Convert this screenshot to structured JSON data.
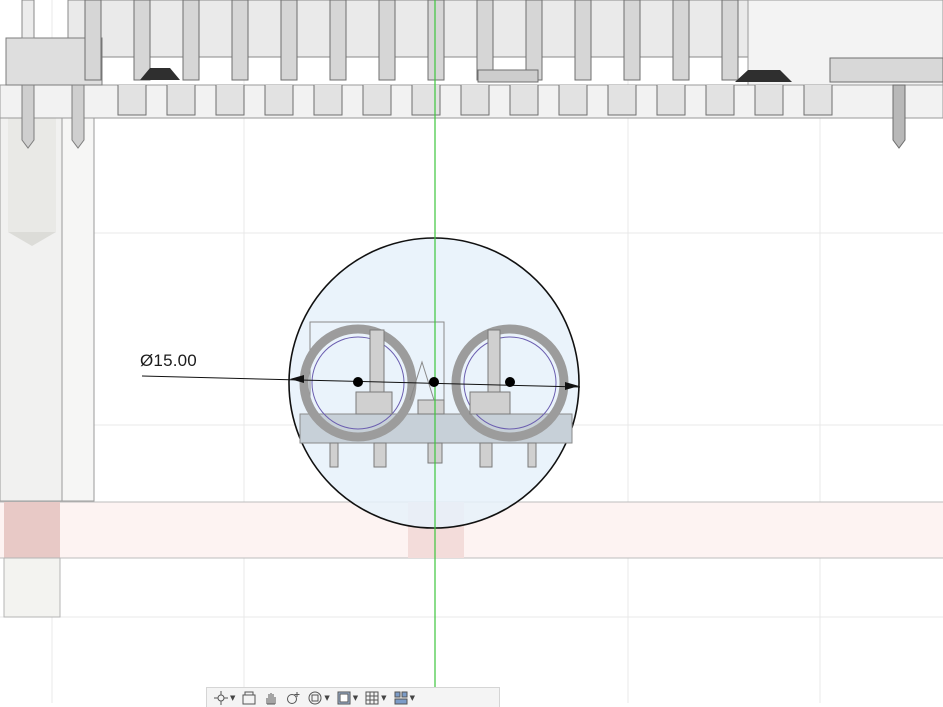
{
  "canvas": {
    "dimension": {
      "label": "Ø15.00"
    },
    "colors": {
      "background": "#ffffff",
      "grid": "#e6e6e6",
      "axis": "#3cc63c",
      "profile_fill": "#e4f0fa",
      "highlight_band": "#f6d6d6",
      "component_gray": "#8e8e8e"
    }
  },
  "toolbar": {
    "items": [
      {
        "name": "orbit-icon",
        "has_dropdown": true
      },
      {
        "name": "look-at-icon",
        "has_dropdown": false
      },
      {
        "name": "pan-icon",
        "has_dropdown": false
      },
      {
        "name": "zoom-icon",
        "has_dropdown": false
      },
      {
        "name": "fit-icon",
        "has_dropdown": true
      },
      {
        "name": "display-settings-icon",
        "has_dropdown": true
      },
      {
        "name": "grid-settings-icon",
        "has_dropdown": true
      },
      {
        "name": "viewports-icon",
        "has_dropdown": true
      }
    ]
  }
}
